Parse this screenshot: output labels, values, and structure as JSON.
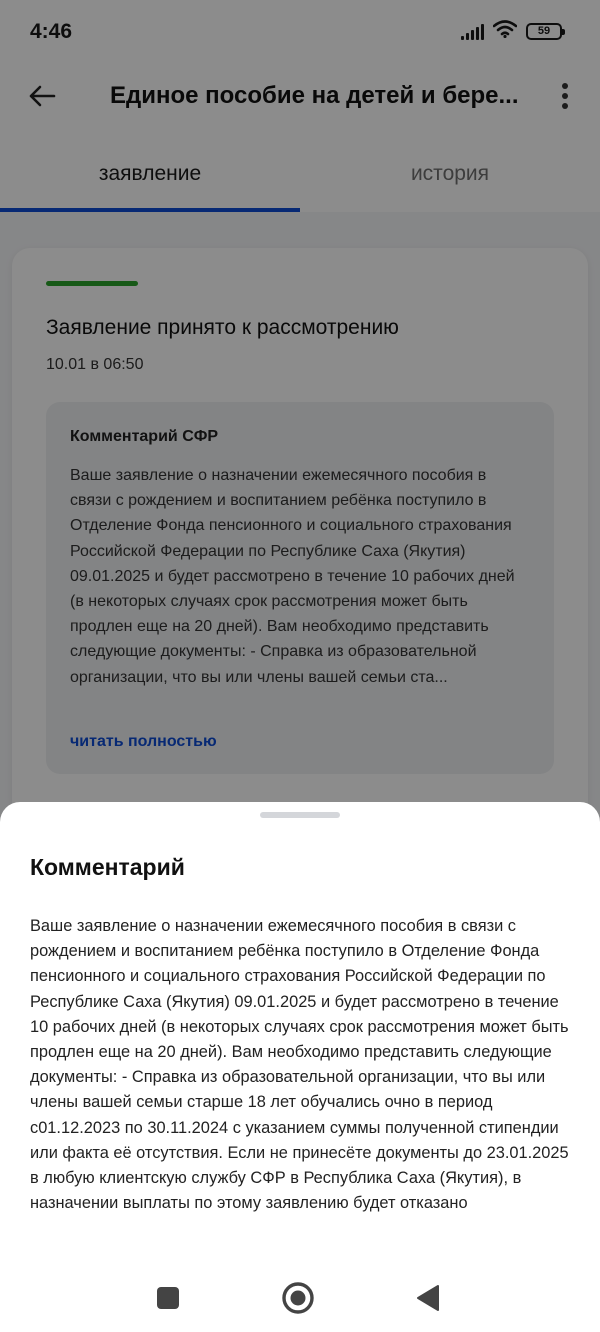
{
  "status_bar": {
    "time": "4:46",
    "battery": "59",
    "icons": [
      "signal-icon",
      "wifi-icon",
      "battery-icon"
    ]
  },
  "app_bar": {
    "title": "Единое пособие на детей и бере...",
    "icons": [
      "arrow-left-icon",
      "more-vertical-icon"
    ]
  },
  "tabs": [
    {
      "label": "заявление",
      "active": true
    },
    {
      "label": "история",
      "active": false
    }
  ],
  "card": {
    "status_color": "#2aa32a",
    "title": "Заявление принято к рассмотрению",
    "date": "10.01 в 06:50",
    "comment_heading": "Комментарий СФР",
    "comment_preview": "Ваше заявление о назначении ежемесячного пособия в связи с рождением и воспитанием ребёнка поступило в Отделение Фонда пенсионного и социального страхования Российской Федерации по Республике Саха (Якутия) 09.01.2025 и будет рассмотрено в течение 10 рабочих дней (в некоторых случаях срок рассмотрения может быть продлен еще на 20 дней). Вам необходимо представить следующие документы: - Справка из образовательной организации, что вы или члены вашей семьи ста...",
    "read_more": "читать полностью"
  },
  "sheet": {
    "title": "Комментарий",
    "body": "Ваше заявление о назначении ежемесячного пособия в связи с рождением и воспитанием ребёнка поступило в Отделение Фонда пенсионного и социального страхования Российской Федерации по Республике Саха (Якутия) 09.01.2025 и будет рассмотрено в течение 10 рабочих дней (в некоторых случаях срок рассмотрения может быть продлен еще на 20 дней). Вам необходимо представить следующие документы: - Справка из образовательной организации, что вы или члены вашей семьи старше 18 лет обучались очно в период с01.12.2023 по 30.11.2024 с указанием суммы полученной стипендии или факта её отсутствия. Если не принесёте документы до 23.01.2025 в любую клиентскую службу СФР в Республика Саха (Якутия), в назначении выплаты по этому заявлению будет отказано"
  },
  "nav_bar": {
    "icons": [
      "recents-square-icon",
      "home-circle-icon",
      "back-triangle-icon"
    ]
  },
  "colors": {
    "accent": "#0d4cd3",
    "status_ok": "#2aa32a",
    "scrim": "rgba(0,0,0,0.45)"
  }
}
